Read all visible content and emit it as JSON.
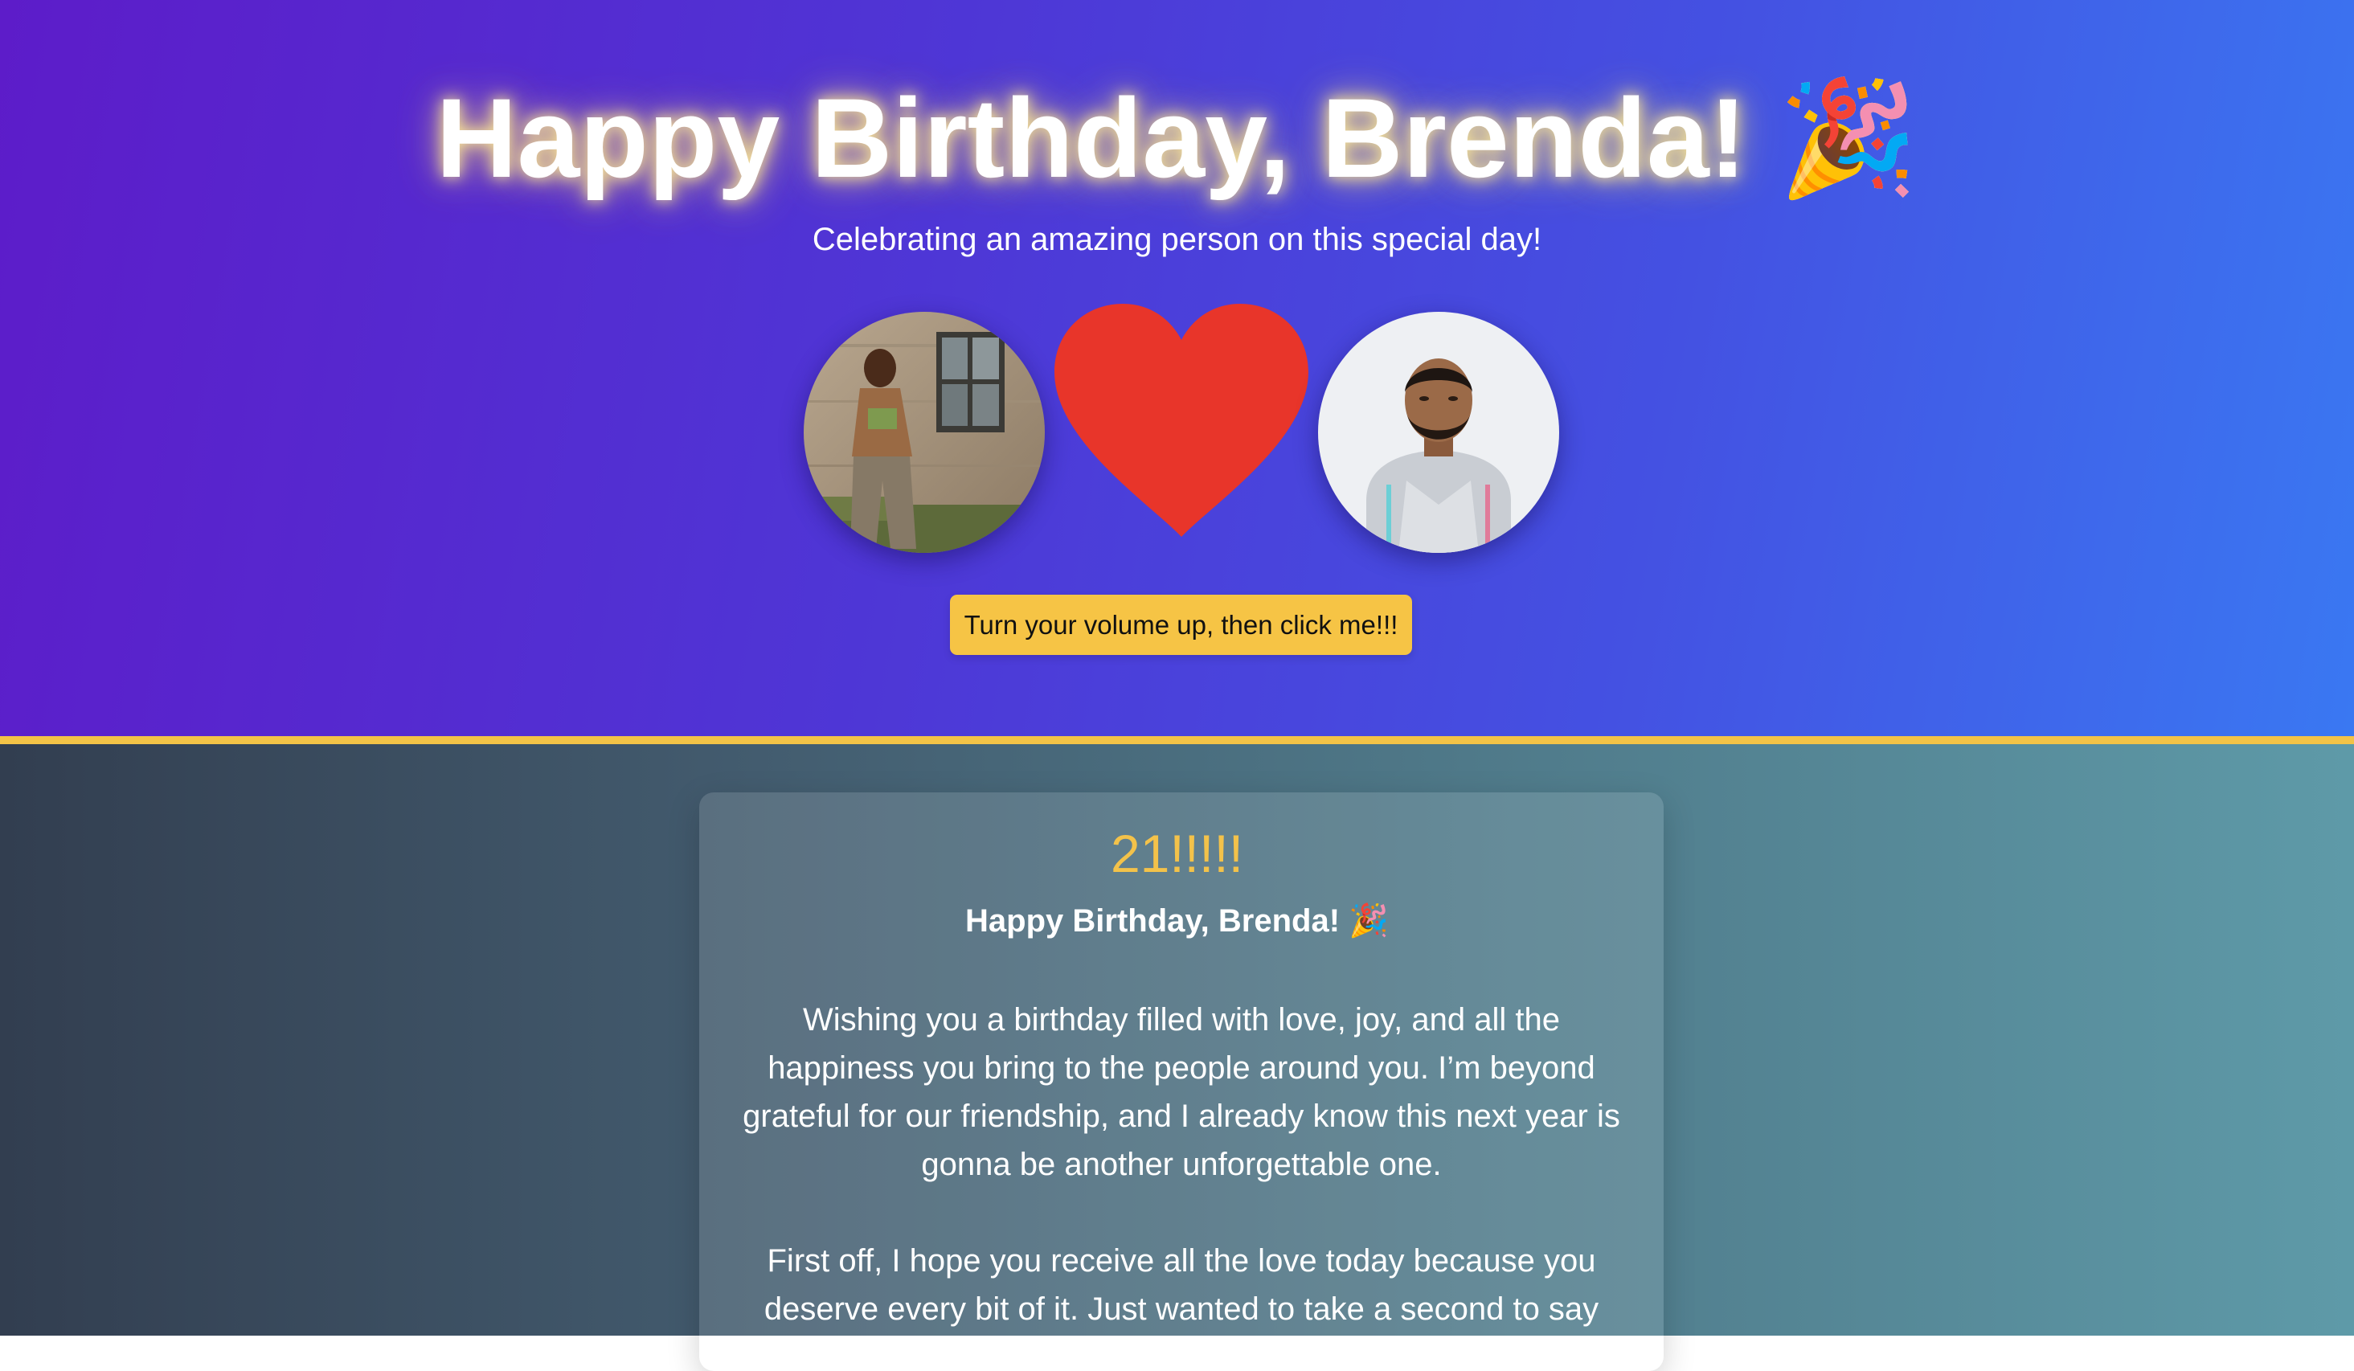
{
  "hero": {
    "title": "Happy Birthday, Brenda!",
    "title_emoji": "🎉",
    "subtitle": "Celebrating an amazing person on this special day!",
    "volume_button_label": "Turn your volume up, then click me!!!"
  },
  "colors": {
    "hero_gradient_start": "#5d1cc9",
    "hero_gradient_end": "#3a78f2",
    "heart": "#e8352a",
    "button": "#f6c445",
    "divider": "#f3c347",
    "age_text": "#f3c24a",
    "lower_gradient_start": "#323e50",
    "lower_gradient_end": "#5e9aa8"
  },
  "icons": {
    "heart": "heart-icon"
  },
  "message_card": {
    "age": "21!!!!!",
    "heading": "Happy Birthday, Brenda! 🎉",
    "paragraphs": [
      "Wishing you a birthday filled with love, joy, and all the happiness you bring to the people around you. I’m beyond grateful for our friendship, and I already know this next year is gonna be another unforgettable one.",
      "First off, I hope you receive all the love today because you deserve every bit of it. Just wanted to take a second to say"
    ]
  }
}
